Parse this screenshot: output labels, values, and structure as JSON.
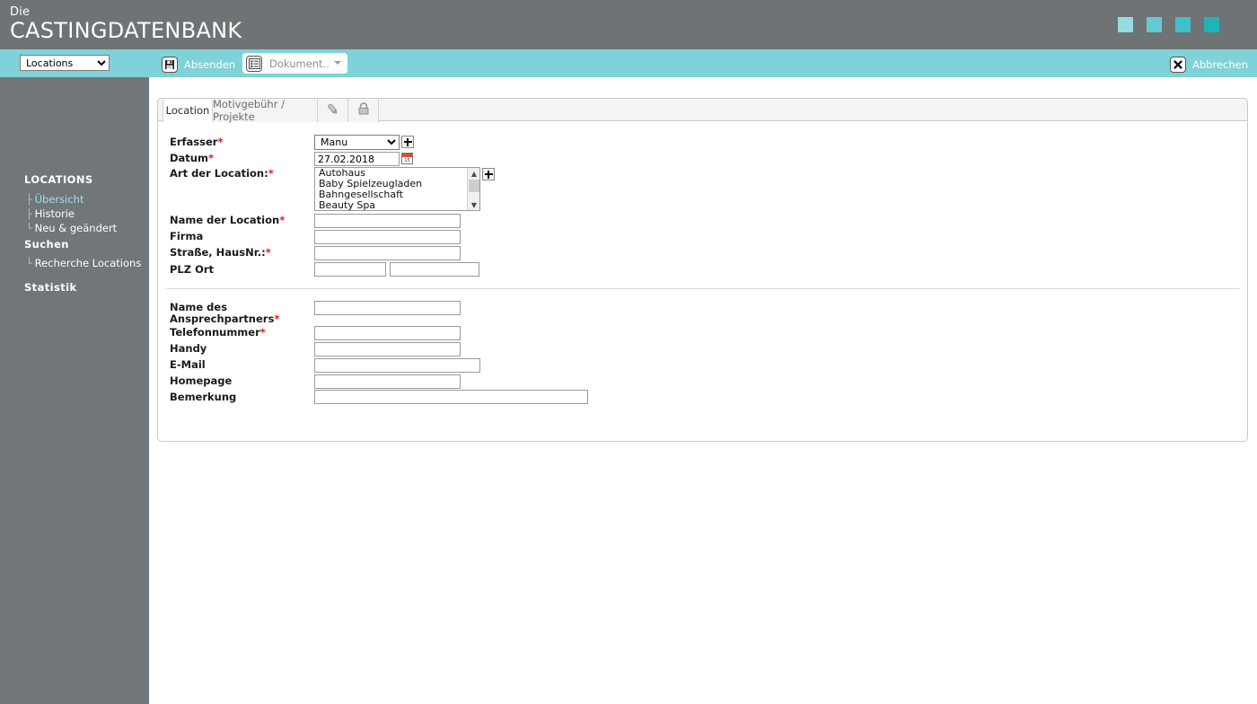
{
  "header": {
    "brand_small": "Die",
    "brand_main": "CASTINGDATENBANK",
    "swatch_colors": [
      "#95dbdf",
      "#62ccd2",
      "#3fc0c7",
      "#21b3ba"
    ],
    "bg_color": "#6e7376"
  },
  "toolbar": {
    "bg_color": "#7ed2d8",
    "module_select_value": "Locations",
    "module_select_options": [
      "Locations"
    ],
    "submit_label": "Absenden",
    "submit_icon": "save-disk-icon",
    "document_label": "Dokument..",
    "document_icon": "document-list-icon",
    "document_caret_icon": "chevron-down-icon",
    "cancel_label": "Abbrechen",
    "cancel_icon": "close-x-icon"
  },
  "sidebar": {
    "bg_color": "#70767a",
    "groups": [
      {
        "heading": "LOCATIONS",
        "items": [
          {
            "label": "Übersicht",
            "active": true
          },
          {
            "label": "Historie",
            "active": false
          },
          {
            "label": "Neu & geändert",
            "active": false
          }
        ]
      },
      {
        "heading": "Suchen",
        "items": [
          {
            "label": "Recherche Locations",
            "active": false
          }
        ]
      },
      {
        "heading": "Statistik",
        "items": []
      }
    ]
  },
  "tabs": [
    {
      "label": "Location",
      "active": true
    },
    {
      "label": "Motivgebühr / Projekte",
      "active": false
    },
    {
      "label": "",
      "icon": "pencil-icon",
      "active": false
    },
    {
      "label": "",
      "icon": "lock-icon",
      "active": false
    }
  ],
  "form": {
    "erfasser": {
      "label": "Erfasser",
      "required": true,
      "value": "Manu",
      "options": [
        "Manu"
      ],
      "add_icon": "plus-icon"
    },
    "datum": {
      "label": "Datum",
      "required": true,
      "value": "27.02.2018",
      "calendar_icon": "calendar-icon",
      "calendar_day": "15"
    },
    "art_der_location": {
      "label": "Art der Location:",
      "required": true,
      "options": [
        "Autohaus",
        "Baby Spielzeugladen",
        "Bahngesellschaft",
        "Beauty Spa"
      ],
      "selected": [],
      "add_icon": "plus-icon",
      "scrollbar_up_icon": "chevron-up-icon",
      "scrollbar_down_icon": "chevron-down-icon"
    },
    "name_der_location": {
      "label": "Name der Location",
      "required": true,
      "value": ""
    },
    "firma": {
      "label": "Firma",
      "required": false,
      "value": ""
    },
    "strasse": {
      "label": "Straße, HausNr.:",
      "required": true,
      "value": ""
    },
    "plz_ort": {
      "label": "PLZ Ort",
      "required": false,
      "plz_value": "",
      "ort_value": ""
    },
    "ansprechpartner": {
      "label_line1": "Name des",
      "label_line2": "Ansprechpartners",
      "required": true,
      "value": ""
    },
    "telefonnummer": {
      "label": "Telefonnummer",
      "required": true,
      "value": ""
    },
    "handy": {
      "label": "Handy",
      "required": false,
      "value": ""
    },
    "email": {
      "label": "E-Mail",
      "required": false,
      "value": ""
    },
    "homepage": {
      "label": "Homepage",
      "required": false,
      "value": ""
    },
    "bemerkung": {
      "label": "Bemerkung",
      "required": false,
      "value": ""
    }
  }
}
